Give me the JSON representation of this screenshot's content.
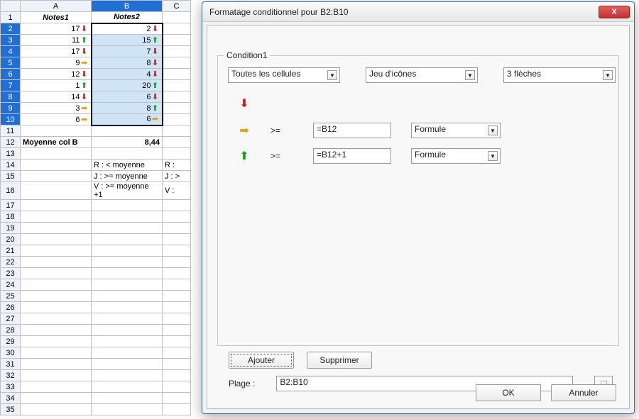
{
  "dialog": {
    "title": "Formatage conditionnel pour B2:B10",
    "condition_label": "Condition1",
    "scope_select": "Toutes les cellules",
    "style_select": "Jeu d'icônes",
    "iconset_select": "3 flèches",
    "rules": [
      {
        "icon": "down",
        "op": "",
        "value": "",
        "mode": ""
      },
      {
        "icon": "right",
        "op": ">=",
        "value": "=B12",
        "mode": "Formule"
      },
      {
        "icon": "up",
        "op": ">=",
        "value": "=B12+1",
        "mode": "Formule"
      }
    ],
    "add_btn": "Ajouter",
    "del_btn": "Supprimer",
    "range_label": "Plage :",
    "range_value": "B2:B10",
    "ok_btn": "OK",
    "cancel_btn": "Annuler"
  },
  "sheet": {
    "col_headers": [
      "A",
      "B",
      "C"
    ],
    "rows": [
      {
        "r": 1,
        "A": "Notes1",
        "B": "Notes2",
        "hdr": true
      },
      {
        "r": 2,
        "A": "17",
        "Ai": "down",
        "B": "2",
        "Bi": "down"
      },
      {
        "r": 3,
        "A": "11",
        "Ai": "up",
        "B": "15",
        "Bi": "up"
      },
      {
        "r": 4,
        "A": "17",
        "Ai": "down",
        "B": "7",
        "Bi": "down"
      },
      {
        "r": 5,
        "A": "9",
        "Ai": "right",
        "B": "8",
        "Bi": "down"
      },
      {
        "r": 6,
        "A": "12",
        "Ai": "down",
        "B": "4",
        "Bi": "down"
      },
      {
        "r": 7,
        "A": "1",
        "Ai": "up",
        "B": "20",
        "Bi": "up"
      },
      {
        "r": 8,
        "A": "14",
        "Ai": "down",
        "B": "6",
        "Bi": "down"
      },
      {
        "r": 9,
        "A": "3",
        "Ai": "right",
        "B": "8",
        "Bi": "up"
      },
      {
        "r": 10,
        "A": "6",
        "Ai": "right",
        "B": "6",
        "Bi": "right"
      },
      {
        "r": 11,
        "A": "",
        "B": ""
      },
      {
        "r": 12,
        "A": "Moyenne col B",
        "B": "8,44",
        "bold": true
      },
      {
        "r": 13,
        "A": "",
        "B": ""
      },
      {
        "r": 14,
        "A": "",
        "B": "R : < moyenne",
        "C": "R :"
      },
      {
        "r": 15,
        "A": "",
        "B": "J : >= moyenne",
        "C": "J : >"
      },
      {
        "r": 16,
        "A": "",
        "B": "V : >= moyenne +1",
        "C": "V :"
      },
      {
        "r": 17
      },
      {
        "r": 18
      },
      {
        "r": 19
      },
      {
        "r": 20
      },
      {
        "r": 21
      },
      {
        "r": 22
      },
      {
        "r": 23
      },
      {
        "r": 24
      },
      {
        "r": 25
      },
      {
        "r": 26
      },
      {
        "r": 27
      },
      {
        "r": 28
      },
      {
        "r": 29
      },
      {
        "r": 30
      },
      {
        "r": 31
      },
      {
        "r": 32
      },
      {
        "r": 33
      },
      {
        "r": 34
      },
      {
        "r": 35
      }
    ],
    "selection": {
      "col": "B",
      "from": 2,
      "to": 10
    }
  }
}
